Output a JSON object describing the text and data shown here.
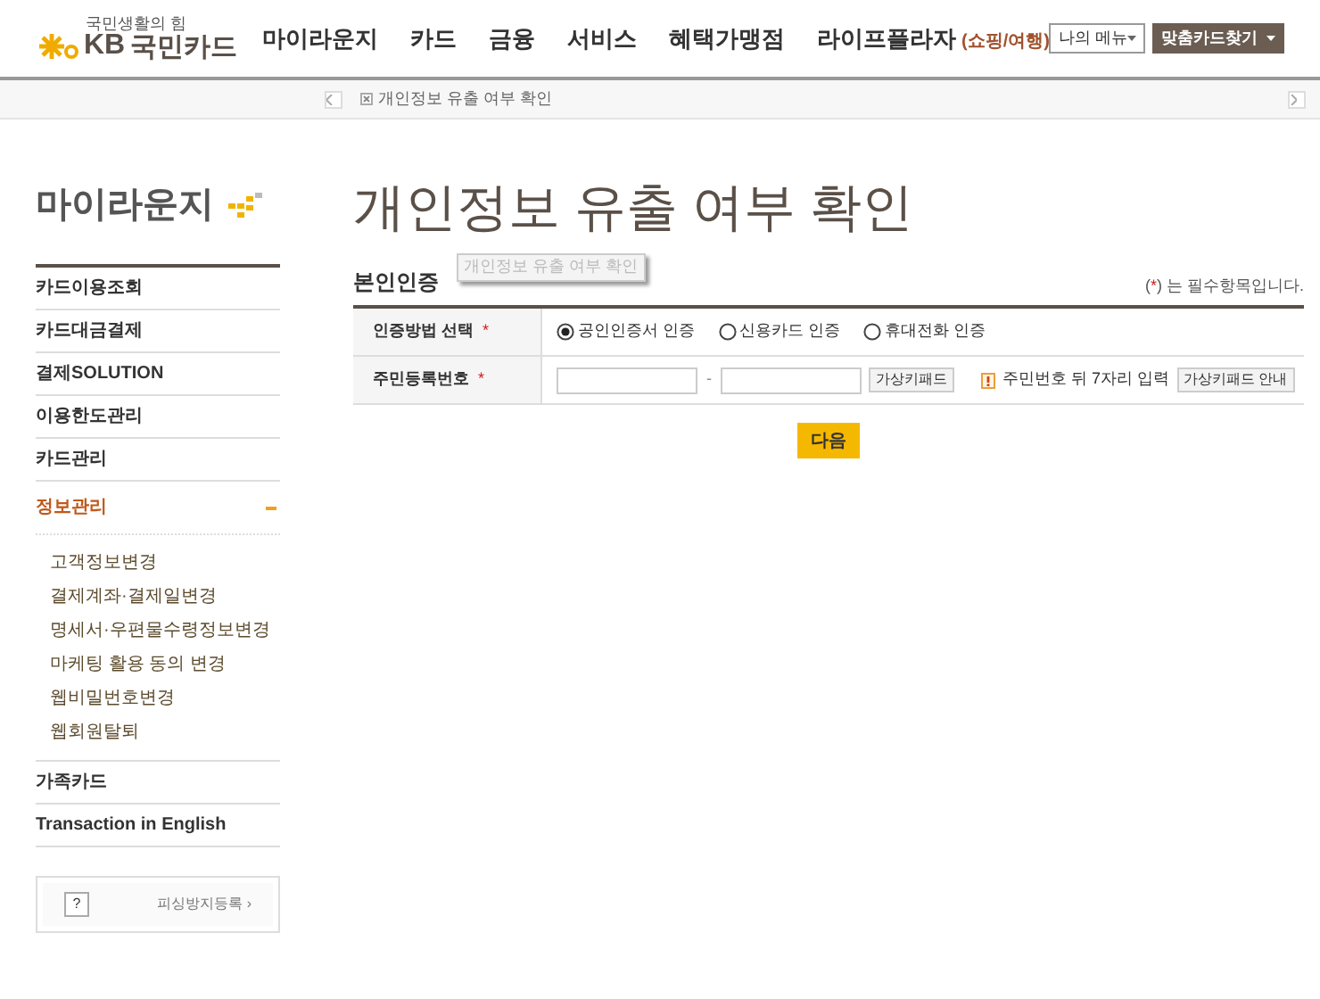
{
  "header": {
    "tagline": "국민생활의 힘",
    "brand": "KB",
    "brand_name": "국민카드",
    "nav": [
      {
        "label": "마이라운지"
      },
      {
        "label": "카드"
      },
      {
        "label": "금융"
      },
      {
        "label": "서비스"
      },
      {
        "label": "혜택가맹점"
      },
      {
        "label": "라이프플라자",
        "note": "(쇼핑/여행)"
      }
    ],
    "my_menu": "나의 메뉴",
    "find_card": "맞춤카드찾기"
  },
  "breadcrumb": {
    "current": "개인정보 유출 여부 확인"
  },
  "sidebar": {
    "title": "마이라운지",
    "items": [
      {
        "label": "카드이용조회",
        "expanded": false
      },
      {
        "label": "카드대금결제",
        "expanded": false
      },
      {
        "label": "결제SOLUTION",
        "expanded": false
      },
      {
        "label": "이용한도관리",
        "expanded": false
      },
      {
        "label": "카드관리",
        "expanded": false
      },
      {
        "label": "정보관리",
        "expanded": true,
        "children": [
          {
            "label": "고객정보변경"
          },
          {
            "label": "결제계좌·결제일변경"
          },
          {
            "label": "명세서·우편물수령정보변경"
          },
          {
            "label": "마케팅 활용 동의 변경"
          },
          {
            "label": "웹비밀번호변경"
          },
          {
            "label": "웹회원탈퇴"
          }
        ]
      },
      {
        "label": "가족카드",
        "expanded": false
      },
      {
        "label": "Transaction in English",
        "expanded": false
      }
    ],
    "help": {
      "icon": "?",
      "link": "피싱방지등록 ›"
    }
  },
  "page": {
    "title": "개인정보 유출 여부 확인",
    "tooltip": "개인정보 유출 여부 확인",
    "section": "본인인증",
    "required_note": {
      "open": "(",
      "mark": "*",
      "close": ")",
      "text": "는 필수항목입니다."
    },
    "rows": [
      {
        "kind": "radio",
        "label": "인증방법 선택",
        "required": true,
        "options": [
          {
            "label": "공인인증서 인증",
            "selected": true
          },
          {
            "label": "신용카드 인증",
            "selected": false
          },
          {
            "label": "휴대전화 인증",
            "selected": false
          }
        ]
      },
      {
        "kind": "ssn",
        "label": "주민등록번호",
        "required": true,
        "separator": "-",
        "keypad": "가상키패드",
        "hint": "주민번호 뒤 7자리 입력",
        "guide": "가상키패드 안내"
      }
    ],
    "next": "다음"
  }
}
